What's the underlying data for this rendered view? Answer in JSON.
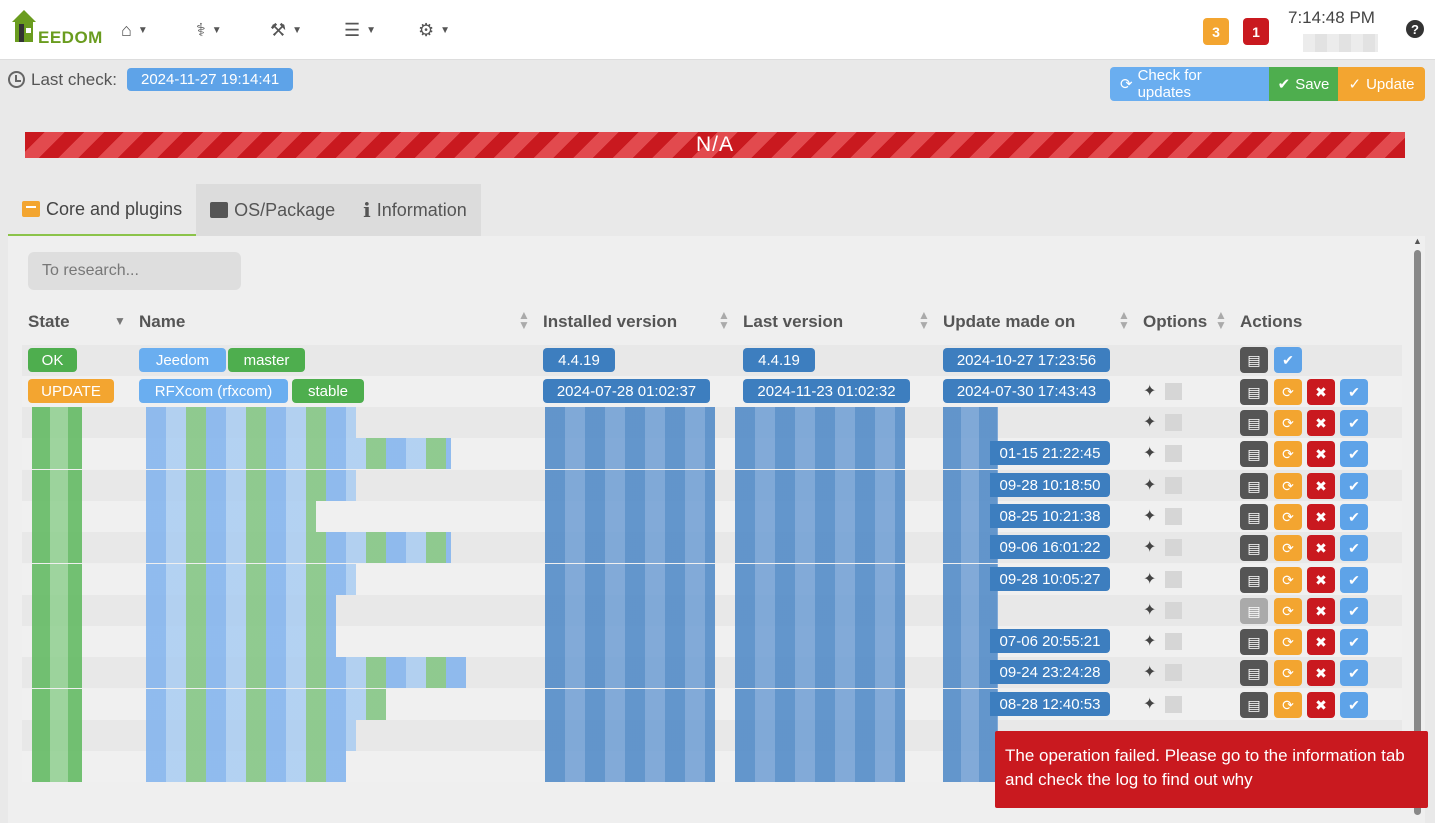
{
  "navbar": {
    "logo_text": "EEDOM",
    "menus": [
      {
        "name": "home-icon",
        "glyph": "⌂"
      },
      {
        "name": "stethoscope-icon",
        "glyph": "⚕"
      },
      {
        "name": "wrench-icon",
        "glyph": "🔧"
      },
      {
        "name": "tasks-icon",
        "glyph": "☰"
      },
      {
        "name": "gear-icon",
        "glyph": "⚙"
      }
    ],
    "badge_orange": "3",
    "badge_red": "1",
    "clock": "7:14:48 PM",
    "help": "?"
  },
  "last_check": {
    "label": "Last check:",
    "value": "2024-11-27 19:14:41"
  },
  "toolbar": {
    "check_label": "Check for updates",
    "save_label": "Save",
    "update_label": "Update"
  },
  "progress": {
    "text": "N/A"
  },
  "tabs": [
    {
      "label": "Core and plugins",
      "active": true
    },
    {
      "label": "OS/Package",
      "active": false
    },
    {
      "label": "Information",
      "active": false
    }
  ],
  "search": {
    "placeholder": "To research..."
  },
  "table": {
    "headers": {
      "state": "State",
      "name": "Name",
      "installed": "Installed version",
      "last": "Last version",
      "updated": "Update made on",
      "options": "Options",
      "actions": "Actions"
    },
    "rows": [
      {
        "state": "OK",
        "name": "Jeedom",
        "branch": "master",
        "installed": "4.4.19",
        "last": "4.4.19",
        "updated": "2024-10-27 17:23:56"
      },
      {
        "state": "UPDATE",
        "name": "RFXcom (rfxcom)",
        "branch": "stable",
        "installed": "2024-07-28 01:02:37",
        "last": "2024-11-23 01:02:32",
        "updated": "2024-07-30 17:43:43"
      }
    ],
    "partial_dates": [
      "",
      "01-15 21:22:45",
      "09-28 10:18:50",
      "08-25 10:21:38",
      "09-06 16:01:22",
      "09-28 10:05:27",
      "",
      "07-06 20:55:21",
      "09-24 23:24:28",
      "08-28 12:40:53"
    ]
  },
  "toast": {
    "message": "The operation failed. Please go to the information tab and check the log to find out why"
  },
  "colors": {
    "green": "#4eae4e",
    "orange": "#f3a530",
    "red": "#c9191f",
    "light_blue": "#6aaef0",
    "dark_blue": "#3d7ebf"
  }
}
